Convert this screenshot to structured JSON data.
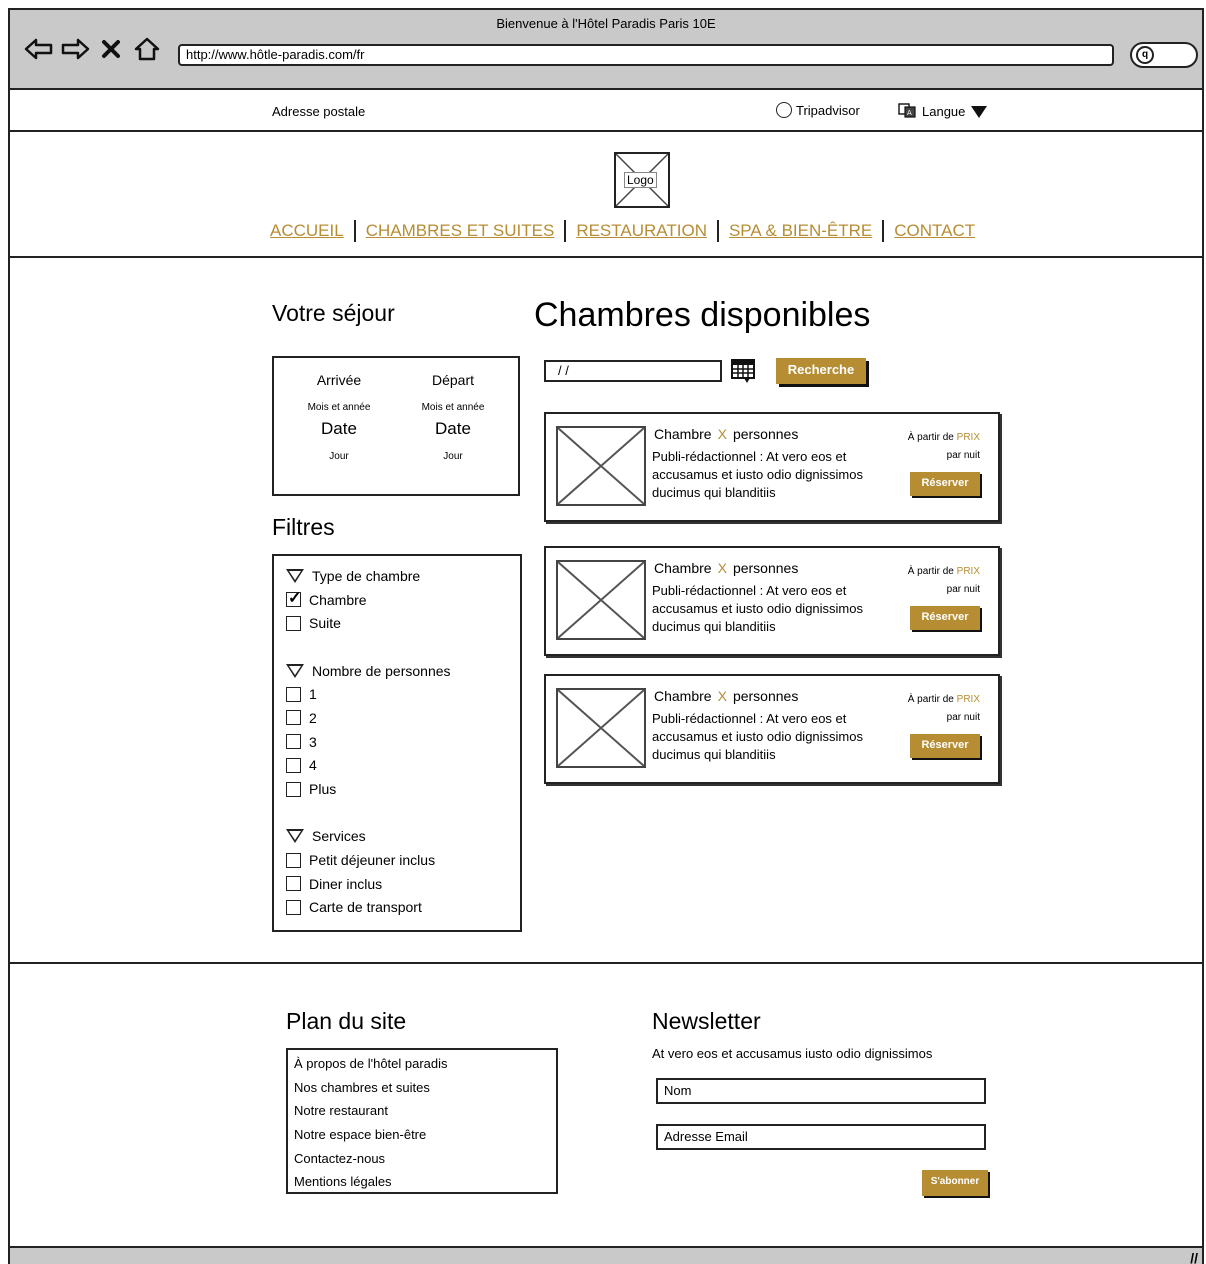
{
  "browser": {
    "title": "Bienvenue à l'Hôtel Paradis Paris 10E",
    "url": "http://www.hôtle-paradis.com/fr"
  },
  "topbar": {
    "address": "Adresse postale",
    "tripadvisor": "Tripadvisor",
    "language": "Langue"
  },
  "header": {
    "logo": "Logo",
    "menu": [
      "ACCUEIL",
      "CHAMBRES ET SUITES",
      "RESTAURATION",
      "SPA & BIEN-ÊTRE",
      "CONTACT"
    ]
  },
  "stay": {
    "title": "Votre séjour",
    "arrival": {
      "label": "Arrivée",
      "month_year": "Mois et année",
      "date": "Date",
      "day": "Jour"
    },
    "departure": {
      "label": "Départ",
      "month_year": "Mois et année",
      "date": "Date",
      "day": "Jour"
    }
  },
  "filters": {
    "title": "Filtres",
    "groups": [
      {
        "label": "Type de chambre",
        "options": [
          {
            "label": "Chambre",
            "checked": true
          },
          {
            "label": "Suite",
            "checked": false
          }
        ]
      },
      {
        "label": "Nombre de personnes",
        "options": [
          {
            "label": "1",
            "checked": false
          },
          {
            "label": "2",
            "checked": false
          },
          {
            "label": "3",
            "checked": false
          },
          {
            "label": "4",
            "checked": false
          },
          {
            "label": "Plus",
            "checked": false
          }
        ]
      },
      {
        "label": "Services",
        "options": [
          {
            "label": "Petit déjeuner inclus",
            "checked": false
          },
          {
            "label": "Diner inclus",
            "checked": false
          },
          {
            "label": "Carte de transport",
            "checked": false
          }
        ]
      }
    ]
  },
  "rooms": {
    "title": "Chambres disponibles",
    "date_value": "/ /",
    "search_label": "Recherche",
    "items": [
      {
        "name": "Chambre",
        "x": "X",
        "persons": "personnes",
        "desc": "Publi-rédactionnel : At vero eos et accusamus et iusto odio dignissimos ducimus qui blanditiis",
        "from": "À partir de",
        "price": "PRIX",
        "per_night": "par nuit",
        "book": "Réserver"
      },
      {
        "name": "Chambre",
        "x": "X",
        "persons": "personnes",
        "desc": "Publi-rédactionnel : At vero eos et accusamus et iusto odio dignissimos ducimus qui blanditiis",
        "from": "À partir de",
        "price": "PRIX",
        "per_night": "par nuit",
        "book": "Réserver"
      },
      {
        "name": "Chambre",
        "x": "X",
        "persons": "personnes",
        "desc": "Publi-rédactionnel : At vero eos et accusamus et iusto odio dignissimos ducimus qui blanditiis",
        "from": "À partir de",
        "price": "PRIX",
        "per_night": "par nuit",
        "book": "Réserver"
      }
    ]
  },
  "footer": {
    "sitemap_title": "Plan du site",
    "sitemap": [
      "À propos de l'hôtel paradis",
      "Nos chambres et suites",
      "Notre restaurant",
      "Notre espace bien-être",
      "Contactez-nous",
      "Mentions légales"
    ],
    "newsletter_title": "Newsletter",
    "newsletter_text": "At vero eos et accusamus iusto odio dignissimos",
    "name_value": "Nom",
    "email_value": "Adresse Email",
    "subscribe": "S'abonner"
  },
  "colors": {
    "accent": "#b78d34",
    "chrome": "#c9c9c9"
  }
}
